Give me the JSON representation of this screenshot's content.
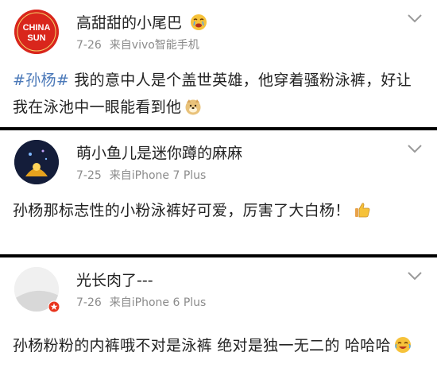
{
  "posts": [
    {
      "username": "高甜甜的小尾巴",
      "date": "7-26",
      "source_prefix": "来自",
      "source_device": "vivo智能手机",
      "avatar_text_line1": "CHINA",
      "avatar_text_line2": "SUN",
      "hashtag": "#孙杨#",
      "text": " 我的意中人是个盖世英雄，他穿着骚粉泳裤，好让我在泳池中一眼能看到他",
      "icons": [
        "crying-face-icon",
        "doge-face-icon",
        "chevron-down-icon"
      ]
    },
    {
      "username": "萌小鱼儿是迷你蹲的麻麻",
      "date": "7-25",
      "source_prefix": "来自",
      "source_device": "iPhone 7 Plus",
      "text": "孙杨那标志性的小粉泳裤好可爱，厉害了大白杨！",
      "icons": [
        "thumbs-up-icon",
        "chevron-down-icon"
      ]
    },
    {
      "username": "光长肉了---",
      "date": "7-26",
      "source_prefix": "来自",
      "source_device": "iPhone 6 Plus",
      "text": "孙杨粉粉的内裤哦不对是泳裤 绝对是独一无二的 哈哈哈",
      "icons": [
        "laughing-cry-icon",
        "chevron-down-icon"
      ]
    }
  ],
  "colors": {
    "hashtag": "#4a78b8",
    "meta_text": "#8b8b8b",
    "divider": "#000000",
    "avatar_red": "#d9261c",
    "emoji_yellow": "#f6c23a"
  }
}
